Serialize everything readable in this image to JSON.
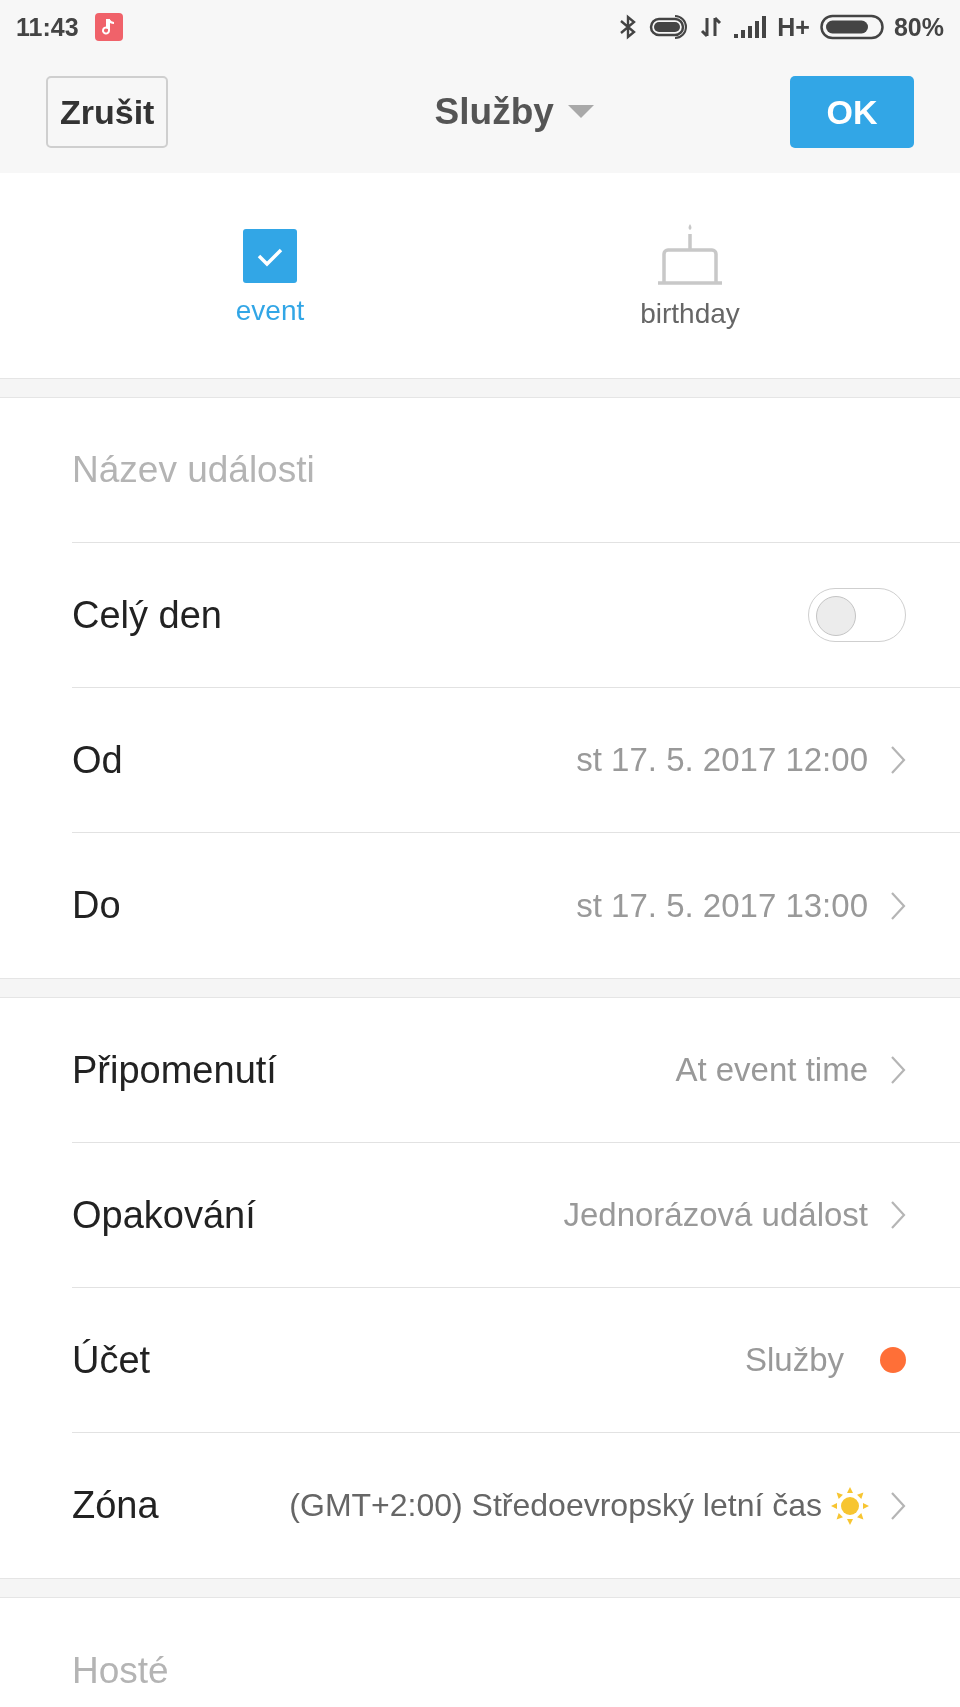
{
  "status_bar": {
    "time": "11:43",
    "battery": "80%",
    "network": "H+"
  },
  "header": {
    "cancel": "Zrušit",
    "title": "Služby",
    "ok": "OK"
  },
  "type_options": [
    {
      "label": "event",
      "kind": "event",
      "selected": true
    },
    {
      "label": "birthday",
      "kind": "birthday",
      "selected": false
    }
  ],
  "sections": [
    {
      "rows": [
        {
          "kind": "field",
          "placeholder": "Název události"
        },
        {
          "kind": "toggle",
          "label": "Celý den",
          "on": false
        },
        {
          "kind": "link",
          "label": "Od",
          "value": "st 17. 5. 2017 12:00"
        },
        {
          "kind": "link",
          "label": "Do",
          "value": "st 17. 5. 2017 13:00"
        }
      ]
    },
    {
      "rows": [
        {
          "kind": "link",
          "label": "Připomenutí",
          "value": "At event time"
        },
        {
          "kind": "link",
          "label": "Opakování",
          "value": "Jednorázová událost"
        },
        {
          "kind": "account",
          "label": "Účet",
          "value": "Služby",
          "color": "#ff6f37"
        },
        {
          "kind": "zone",
          "label": "Zóna",
          "value": "(GMT+2:00) Středoevropský letní čas"
        }
      ]
    },
    {
      "rows": [
        {
          "kind": "field",
          "placeholder": "Hosté"
        }
      ]
    }
  ]
}
